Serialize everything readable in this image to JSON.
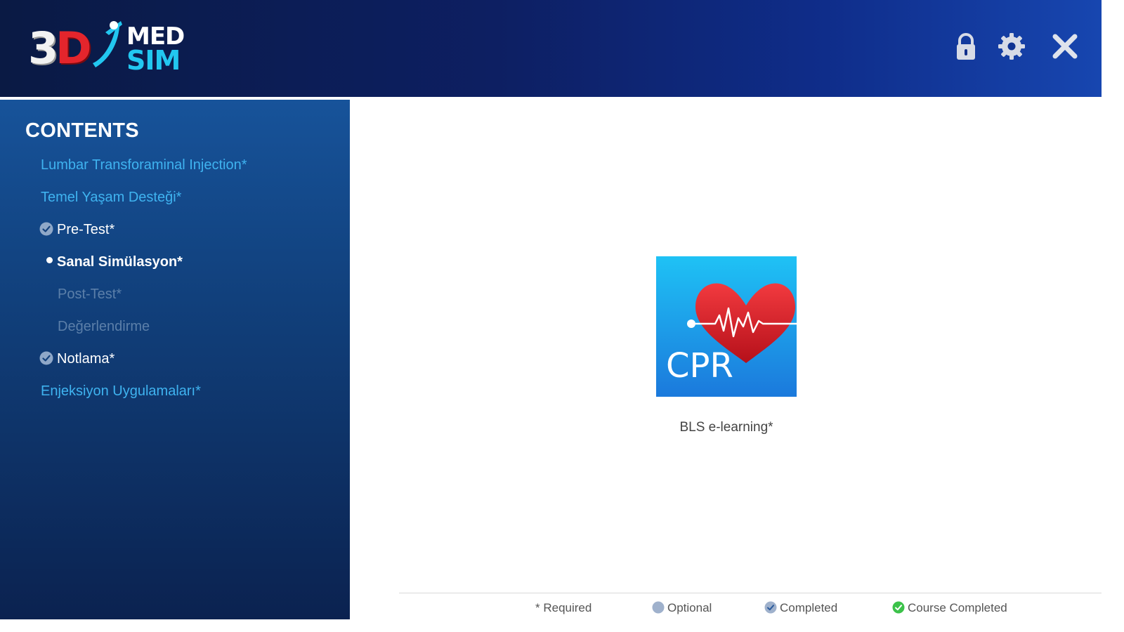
{
  "header": {
    "logo": {
      "part1": "3",
      "part2": "D",
      "line1": "MED",
      "line2": "SIM"
    },
    "icons": [
      "lock-icon",
      "gear-icon",
      "close-icon"
    ]
  },
  "sidebar": {
    "title": "CONTENTS",
    "items": [
      {
        "label": "Lumbar Transforaminal Injection*",
        "state": "link"
      },
      {
        "label": "Temel Yaşam Desteği*",
        "state": "link"
      },
      {
        "label": "Pre-Test*",
        "state": "completed"
      },
      {
        "label": "Sanal Simülasyon*",
        "state": "current"
      },
      {
        "label": "Post-Test*",
        "state": "locked"
      },
      {
        "label": "Değerlendirme",
        "state": "locked"
      },
      {
        "label": "Notlama*",
        "state": "completed"
      },
      {
        "label": "Enjeksiyon Uygulamaları*",
        "state": "link"
      }
    ]
  },
  "main": {
    "card": {
      "image_text": "CPR",
      "label": "BLS e-learning*"
    }
  },
  "legend": {
    "required": "* Required",
    "optional": "Optional",
    "completed": "Completed",
    "course_completed": "Course Completed"
  },
  "colors": {
    "header_dark": "#0a1a44",
    "header_light": "#1746b0",
    "sidebar_top": "#17539a",
    "sidebar_bottom": "#0b2250",
    "link_blue": "#3fb3f0",
    "logo_red": "#e4252c",
    "logo_cyan": "#22c7f0",
    "check_gray": "#8fa8c8",
    "check_green": "#3cc24a"
  }
}
